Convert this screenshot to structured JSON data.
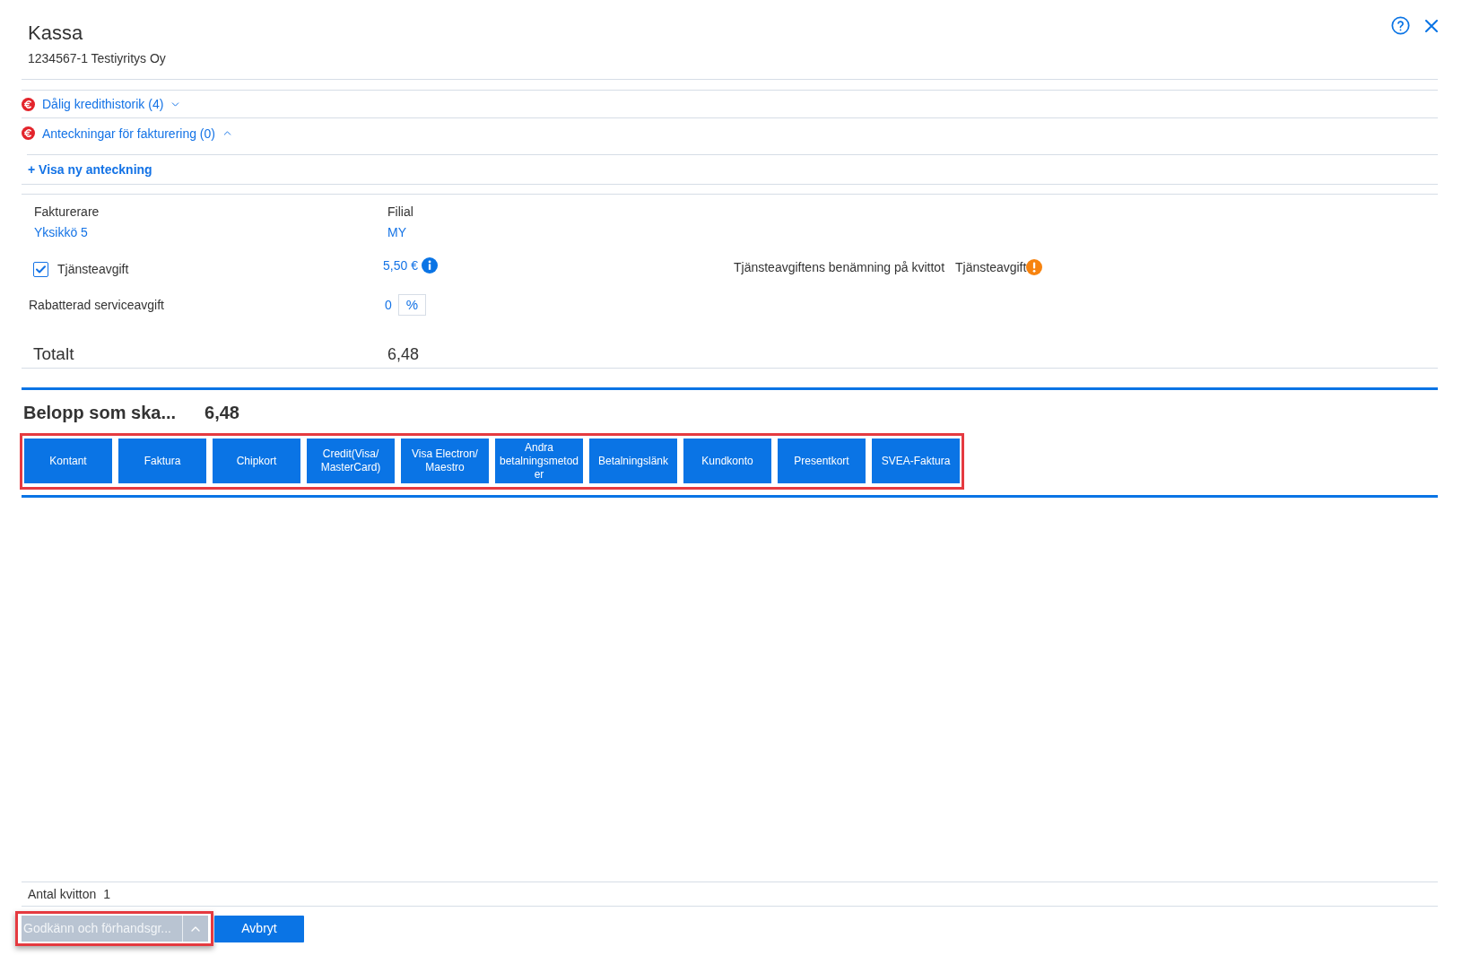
{
  "header": {
    "title": "Kassa",
    "subtitle": "1234567-1 Testiyritys Oy"
  },
  "sections": [
    {
      "label": "Dålig kredithistorik (4)",
      "expanded": false
    },
    {
      "label": "Anteckningar för fakturering (0)",
      "expanded": true,
      "link": "+ Visa ny anteckning"
    }
  ],
  "details": {
    "invoicer": {
      "label": "Fakturerare",
      "value": "Yksikkö 5"
    },
    "branch": {
      "label": "Filial",
      "value": "MY"
    }
  },
  "service_fee": {
    "label": "Tjänsteavgift",
    "checked": true,
    "amount": "5,50 €",
    "receipt_name_label": "Tjänsteavgiftens benämning på kvittot",
    "receipt_name": "Tjänsteavgift"
  },
  "discounted_fee": {
    "label": "Rabatterad serviceavgift",
    "value": "0",
    "unit": "%"
  },
  "total": {
    "label": "Totalt",
    "value": "6,48"
  },
  "amount_due": {
    "label": "Belopp som ska...",
    "value": "6,48"
  },
  "payment_methods": {
    "highlighted": true,
    "buttons": [
      "Kontant",
      "Faktura",
      "Chipkort",
      "Credit(Visa/MasterCard)",
      "Visa Electron/Maestro",
      "Andra betalningsmetoder",
      "Betalningslänk",
      "Kundkonto",
      "Presentkort",
      "SVEA-Faktura"
    ]
  },
  "receipts": {
    "label": "Antal kvitton",
    "value": "1"
  },
  "footer": {
    "approve": {
      "label": "Godkänn och förhandsgr...",
      "disabled": true,
      "highlighted": true
    },
    "cancel": "Avbryt"
  }
}
